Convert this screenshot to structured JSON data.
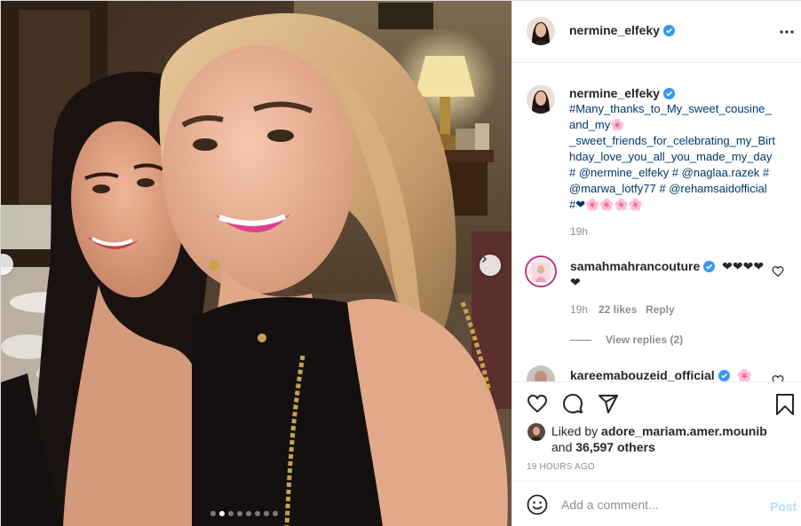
{
  "post": {
    "author": "nermine_elfeky",
    "caption_lines": [
      "#Many_thanks_to_My_sweet_cousine_",
      "and_my🌸",
      "_sweet_friends_for_celebrating_my_Birt",
      "hday_love_you_all_you_made_my_day",
      "# @nermine_elfeky # @naglaa.razek #",
      "@marwa_lotfy77 # @rehamsaidofficial",
      "#❤🌸🌸🌸🌸"
    ],
    "caption_time": "19h",
    "carousel": {
      "total_slides": 8,
      "active_index": 1
    }
  },
  "comments": [
    {
      "username": "samahmahrancouture",
      "text_line1": "❤❤❤❤",
      "text_line2": "❤",
      "time": "19h",
      "likes": "22 likes",
      "reply_label": "Reply",
      "view_replies": "View replies (2)"
    },
    {
      "username": "kareemabouzeid_official",
      "text": "🌸"
    }
  ],
  "likes": {
    "prefix": "Liked by",
    "user": "adore_mariam.amer.mounib",
    "and": "and",
    "others": "36,597 others"
  },
  "timestamp": "19 HOURS AGO",
  "composer": {
    "placeholder": "Add a comment...",
    "post_label": "Post"
  },
  "icons": {
    "heart": "heart-icon",
    "comment": "comment-icon",
    "share": "share-icon",
    "save": "bookmark-icon",
    "more": "more-options-icon",
    "emoji": "emoji-icon",
    "verified": "verified-badge-icon"
  },
  "colors": {
    "link": "#00376b",
    "verified": "#3897f0",
    "post_disabled": "#b2dffc",
    "muted": "#8e8e8e"
  }
}
